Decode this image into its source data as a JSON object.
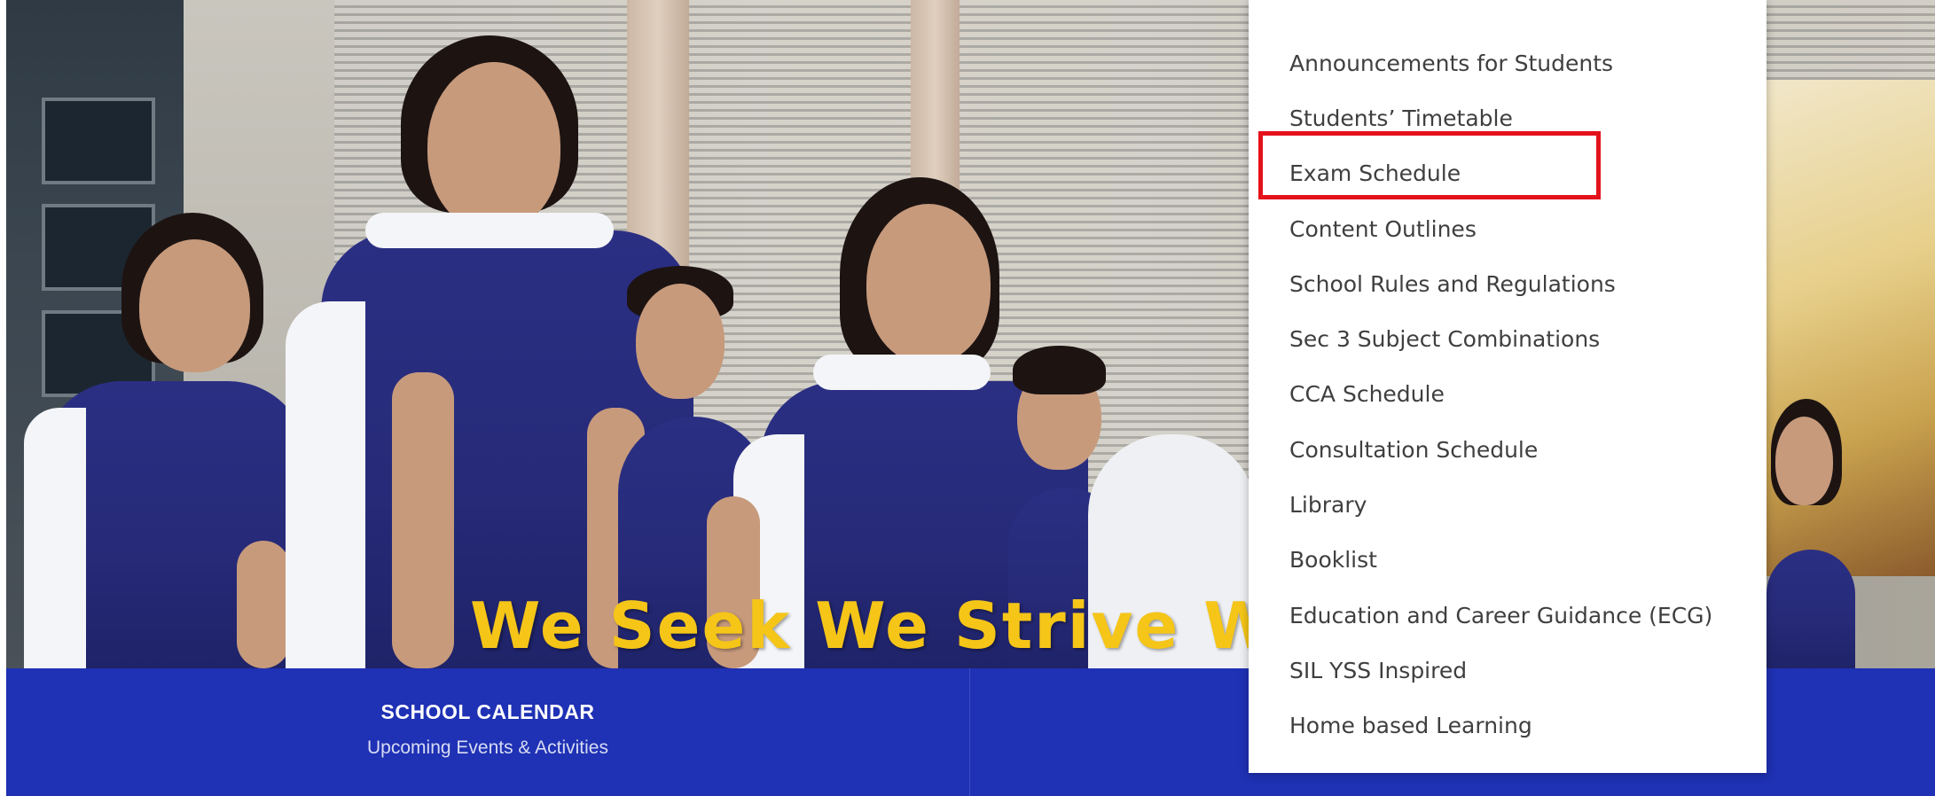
{
  "hero": {
    "motto": "We Seek  We Strive  W"
  },
  "calendar_link": {
    "title": "SCHOOL CALENDAR",
    "subtitle": "Upcoming Events & Activities"
  },
  "dropdown": {
    "items": [
      {
        "label": "Announcements for Students"
      },
      {
        "label": "Students’ Timetable"
      },
      {
        "label": "Exam Schedule"
      },
      {
        "label": "Content Outlines"
      },
      {
        "label": "School Rules and Regulations"
      },
      {
        "label": "Sec 3 Subject Combinations"
      },
      {
        "label": "CCA Schedule"
      },
      {
        "label": "Consultation Schedule"
      },
      {
        "label": "Library"
      },
      {
        "label": "Booklist"
      },
      {
        "label": "Education and Career Guidance (ECG)"
      },
      {
        "label": "SIL YSS Inspired"
      },
      {
        "label": "Home based Learning"
      }
    ],
    "highlighted_item": "Exam Schedule",
    "highlight_color": "#e3121b"
  },
  "colors": {
    "bar_blue": "#1f31b4",
    "motto_yellow": "#f5c518",
    "uniform_navy": "#262a78"
  }
}
